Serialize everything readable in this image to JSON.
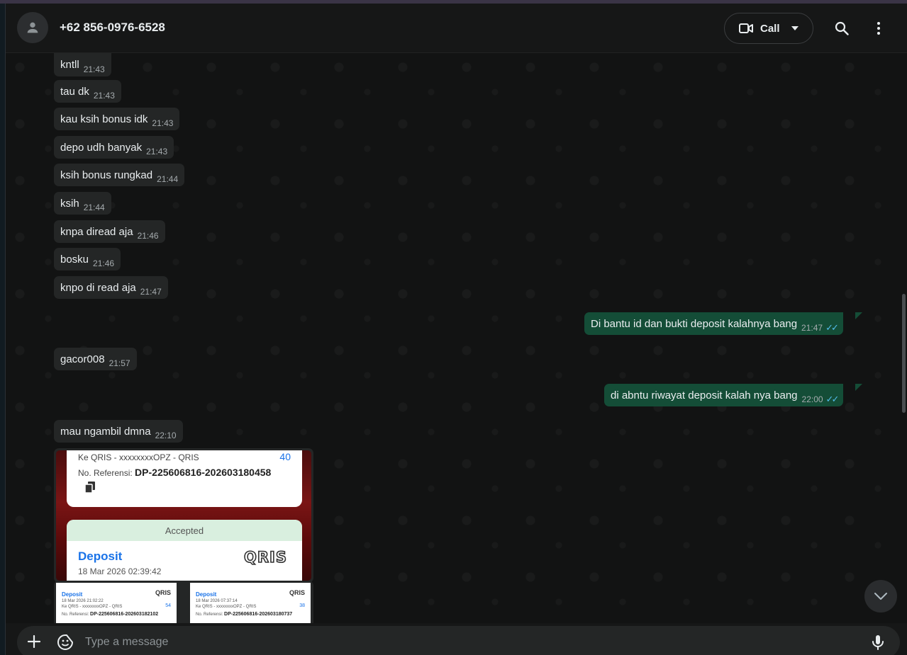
{
  "header": {
    "contact": "+62 856-0976-6528",
    "call_label": "Call"
  },
  "incoming": [
    {
      "text": "kntll",
      "time": "21:43"
    },
    {
      "text": "tau dk",
      "time": "21:43"
    },
    {
      "text": "kau ksih bonus idk",
      "time": "21:43"
    },
    {
      "text": "depo udh banyak",
      "time": "21:43"
    },
    {
      "text": "ksih bonus rungkad",
      "time": "21:44"
    },
    {
      "text": "ksih",
      "time": "21:44"
    },
    {
      "text": "knpa diread aja",
      "time": "21:46"
    },
    {
      "text": "bosku",
      "time": "21:46"
    },
    {
      "text": "knpo di read aja",
      "time": "21:47"
    },
    {
      "text": "gacor008",
      "time": "21:57"
    },
    {
      "text": "mau ngambil dmna",
      "time": "22:10"
    }
  ],
  "outgoing": [
    {
      "text": "Di bantu id dan bukti deposit kalahnya bang",
      "time": "21:47"
    },
    {
      "text": "di abntu riwayat deposit kalah nya bang",
      "time": "22:00"
    }
  ],
  "image_message": {
    "card_top": {
      "line": "Ke QRIS - xxxxxxxxOPZ - QRIS",
      "amount": "40",
      "ref_label": "No. Referensi:",
      "ref_value": "DP-225606816-202603180458"
    },
    "card_bottom": {
      "status": "Accepted",
      "title": "Deposit",
      "date": "18 Mar 2026 02:39:42",
      "brand": "QRIS"
    }
  },
  "thumbnails": [
    {
      "title": "Deposit",
      "date": "18 Mar 2026 21:02:22",
      "line": "Ke QRIS - xxxxxxxxOPZ - QRIS",
      "amount": "54",
      "ref_label": "No. Referensi:",
      "ref_value": "DP-225606816-202603182102",
      "brand": "QRIS"
    },
    {
      "title": "Deposit",
      "date": "18 Mar 2026 07:37:14",
      "line": "Ke QRIS - xxxxxxxxOPZ - QRIS",
      "amount": "38",
      "ref_label": "No. Referensi:",
      "ref_value": "DP-225606816-202603180737",
      "brand": "QRIS"
    }
  ],
  "composer": {
    "placeholder": "Type a message"
  },
  "icons": {
    "avatar": "person-icon",
    "video": "video-camera-icon",
    "dropdown": "chevron-down-icon",
    "search": "search-icon",
    "menu": "more-vertical-icon",
    "scroll": "chevron-down-icon",
    "attach": "plus-icon",
    "emoji": "sticker-icon",
    "mic": "microphone-icon"
  },
  "colors": {
    "outgoing_bubble": "#144d37",
    "incoming_bubble": "#242626",
    "read_ticks": "#53bdeb"
  }
}
